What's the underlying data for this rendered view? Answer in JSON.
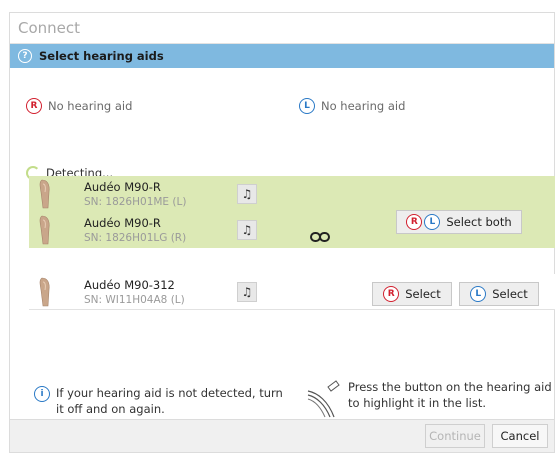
{
  "window": {
    "title": "Connect"
  },
  "section": {
    "title": "Select hearing aids"
  },
  "right_side": {
    "badge": "R",
    "status": "No hearing aid"
  },
  "left_side": {
    "badge": "L",
    "status": "No hearing aid"
  },
  "detecting": {
    "label": "Detecting..."
  },
  "devices": [
    {
      "name": "Audéo M90-R",
      "sn": "SN: 1826H01ME (L)"
    },
    {
      "name": "Audéo M90-R",
      "sn": "SN: 1826H01LG (R)"
    },
    {
      "name": "Audéo M90-312",
      "sn": "SN: WI11H04A8 (L)"
    }
  ],
  "buttons": {
    "select_both": "Select both",
    "select_right": "Select",
    "select_left": "Select",
    "continue": "Continue",
    "cancel": "Cancel"
  },
  "info": {
    "left": "If your hearing aid is not detected, turn it off and on again.",
    "right": "Press the button on the hearing aid to highlight it in the list."
  },
  "colors": {
    "header_bar": "#7fb9e0",
    "paired_row": "#dce9b5",
    "right_badge": "#d2202f",
    "left_badge": "#2a79c6"
  },
  "icons": {
    "help": "question-circle-icon",
    "beep": "music-note-icon",
    "link": "link-icon",
    "info": "info-circle-icon",
    "press": "press-button-icon"
  }
}
